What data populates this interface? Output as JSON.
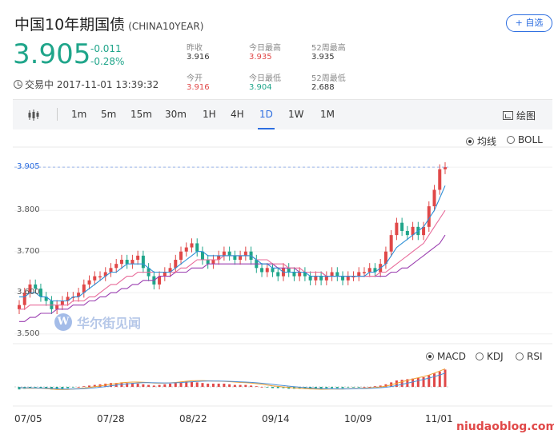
{
  "header": {
    "title": "中国10年期国债",
    "code": "(CHINA10YEAR)",
    "follow_label": "+ 自选"
  },
  "quote": {
    "price": "3.905",
    "change": "-0.011",
    "change_pct": "-0.28%",
    "stats": [
      {
        "label": "昨收",
        "value": "3.916",
        "tone": "neutral"
      },
      {
        "label": "今日最高",
        "value": "3.935",
        "tone": "red"
      },
      {
        "label": "52周最高",
        "value": "3.935",
        "tone": "neutral"
      },
      {
        "label": "今开",
        "value": "3.916",
        "tone": "red"
      },
      {
        "label": "今日最低",
        "value": "3.904",
        "tone": "green"
      },
      {
        "label": "52周最低",
        "value": "2.688",
        "tone": "neutral"
      }
    ],
    "status": "交易中 2017-11-01 13:39:32"
  },
  "toolbar": {
    "periods": [
      "1m",
      "5m",
      "15m",
      "30m",
      "1H",
      "4H",
      "1D",
      "1W",
      "1M"
    ],
    "active_period": "1D",
    "draw_label": "绘图"
  },
  "overlay_options": [
    {
      "label": "均线",
      "selected": true
    },
    {
      "label": "BOLL",
      "selected": false
    }
  ],
  "indicator_options": [
    {
      "label": "MACD",
      "selected": true
    },
    {
      "label": "KDJ",
      "selected": false
    },
    {
      "label": "RSI",
      "selected": false
    }
  ],
  "watermark": {
    "logo": "W",
    "text": "华尔街见闻"
  },
  "site_mark": "niudaoblog.com",
  "colors": {
    "up": "#e04848",
    "down": "#1fa58a",
    "accent": "#2d6ee0",
    "ma1": "#2d8fd6",
    "ma2": "#e86b9a",
    "ma3": "#9b3fb0"
  },
  "chart_data": {
    "type": "candlestick",
    "y_ticks": [
      "3.905",
      "3.800",
      "3.700",
      "3.600",
      "3.500"
    ],
    "x_ticks": [
      "07/05",
      "07/28",
      "08/22",
      "09/14",
      "10/09",
      "11/01"
    ],
    "ylim": [
      3.48,
      3.95
    ],
    "last_price_label": "3.905",
    "last_price_level": 3.905,
    "closes": [
      3.57,
      3.6,
      3.62,
      3.61,
      3.59,
      3.58,
      3.56,
      3.57,
      3.58,
      3.59,
      3.59,
      3.6,
      3.62,
      3.63,
      3.64,
      3.64,
      3.65,
      3.66,
      3.67,
      3.68,
      3.67,
      3.68,
      3.69,
      3.66,
      3.64,
      3.62,
      3.64,
      3.65,
      3.66,
      3.68,
      3.7,
      3.71,
      3.72,
      3.7,
      3.68,
      3.67,
      3.68,
      3.69,
      3.7,
      3.69,
      3.68,
      3.69,
      3.7,
      3.68,
      3.66,
      3.65,
      3.66,
      3.65,
      3.64,
      3.66,
      3.65,
      3.64,
      3.65,
      3.64,
      3.63,
      3.64,
      3.63,
      3.64,
      3.65,
      3.64,
      3.63,
      3.64,
      3.64,
      3.65,
      3.65,
      3.66,
      3.65,
      3.67,
      3.7,
      3.74,
      3.77,
      3.75,
      3.74,
      3.76,
      3.74,
      3.76,
      3.81,
      3.85,
      3.9,
      3.905
    ],
    "ma_short": [
      3.59,
      3.59,
      3.6,
      3.6,
      3.59,
      3.59,
      3.58,
      3.58,
      3.58,
      3.58,
      3.59,
      3.59,
      3.6,
      3.61,
      3.62,
      3.63,
      3.64,
      3.65,
      3.65,
      3.66,
      3.67,
      3.67,
      3.67,
      3.67,
      3.66,
      3.65,
      3.65,
      3.65,
      3.65,
      3.66,
      3.67,
      3.68,
      3.69,
      3.7,
      3.7,
      3.69,
      3.69,
      3.69,
      3.69,
      3.69,
      3.69,
      3.69,
      3.69,
      3.69,
      3.68,
      3.67,
      3.67,
      3.66,
      3.66,
      3.65,
      3.65,
      3.65,
      3.65,
      3.65,
      3.64,
      3.64,
      3.64,
      3.64,
      3.64,
      3.64,
      3.64,
      3.64,
      3.64,
      3.64,
      3.64,
      3.65,
      3.65,
      3.66,
      3.67,
      3.69,
      3.71,
      3.72,
      3.73,
      3.74,
      3.75,
      3.76,
      3.78,
      3.8,
      3.83,
      3.86
    ],
    "ma_mid": [
      3.56,
      3.56,
      3.57,
      3.57,
      3.57,
      3.57,
      3.57,
      3.57,
      3.57,
      3.57,
      3.58,
      3.58,
      3.58,
      3.59,
      3.59,
      3.6,
      3.61,
      3.62,
      3.62,
      3.63,
      3.64,
      3.64,
      3.65,
      3.65,
      3.65,
      3.65,
      3.65,
      3.65,
      3.65,
      3.65,
      3.66,
      3.66,
      3.67,
      3.68,
      3.68,
      3.68,
      3.68,
      3.68,
      3.69,
      3.69,
      3.69,
      3.69,
      3.69,
      3.69,
      3.68,
      3.68,
      3.68,
      3.67,
      3.67,
      3.67,
      3.66,
      3.66,
      3.66,
      3.65,
      3.65,
      3.65,
      3.65,
      3.64,
      3.64,
      3.64,
      3.64,
      3.64,
      3.64,
      3.64,
      3.64,
      3.64,
      3.64,
      3.65,
      3.65,
      3.66,
      3.67,
      3.68,
      3.69,
      3.7,
      3.71,
      3.72,
      3.74,
      3.76,
      3.78,
      3.8
    ],
    "ma_long": [
      3.53,
      3.53,
      3.54,
      3.54,
      3.55,
      3.55,
      3.55,
      3.56,
      3.56,
      3.56,
      3.57,
      3.57,
      3.57,
      3.58,
      3.58,
      3.59,
      3.59,
      3.6,
      3.6,
      3.61,
      3.61,
      3.62,
      3.62,
      3.63,
      3.63,
      3.63,
      3.64,
      3.64,
      3.64,
      3.65,
      3.65,
      3.65,
      3.66,
      3.66,
      3.66,
      3.67,
      3.67,
      3.67,
      3.67,
      3.67,
      3.67,
      3.67,
      3.67,
      3.67,
      3.67,
      3.67,
      3.67,
      3.67,
      3.66,
      3.66,
      3.66,
      3.66,
      3.65,
      3.65,
      3.65,
      3.65,
      3.65,
      3.64,
      3.64,
      3.64,
      3.64,
      3.64,
      3.64,
      3.64,
      3.64,
      3.64,
      3.64,
      3.64,
      3.64,
      3.65,
      3.65,
      3.66,
      3.66,
      3.67,
      3.68,
      3.69,
      3.7,
      3.71,
      3.72,
      3.74
    ],
    "macd_hist": [
      -0.4,
      -0.3,
      -0.2,
      -0.1,
      -0.2,
      -0.3,
      -0.4,
      -0.4,
      -0.3,
      -0.2,
      -0.1,
      0.0,
      0.1,
      0.2,
      0.3,
      0.4,
      0.5,
      0.6,
      0.6,
      0.7,
      0.6,
      0.6,
      0.5,
      0.4,
      0.3,
      0.2,
      0.3,
      0.4,
      0.5,
      0.6,
      0.7,
      0.8,
      0.8,
      0.7,
      0.6,
      0.5,
      0.5,
      0.5,
      0.5,
      0.4,
      0.3,
      0.3,
      0.3,
      0.2,
      0.1,
      0.0,
      -0.1,
      -0.2,
      -0.2,
      -0.2,
      -0.3,
      -0.3,
      -0.3,
      -0.3,
      -0.3,
      -0.3,
      -0.3,
      -0.2,
      -0.2,
      -0.2,
      -0.2,
      -0.1,
      -0.1,
      -0.1,
      0.0,
      0.0,
      0.1,
      0.2,
      0.4,
      0.7,
      1.0,
      1.1,
      1.2,
      1.3,
      1.4,
      1.5,
      1.8,
      2.1,
      2.4,
      2.7
    ]
  }
}
